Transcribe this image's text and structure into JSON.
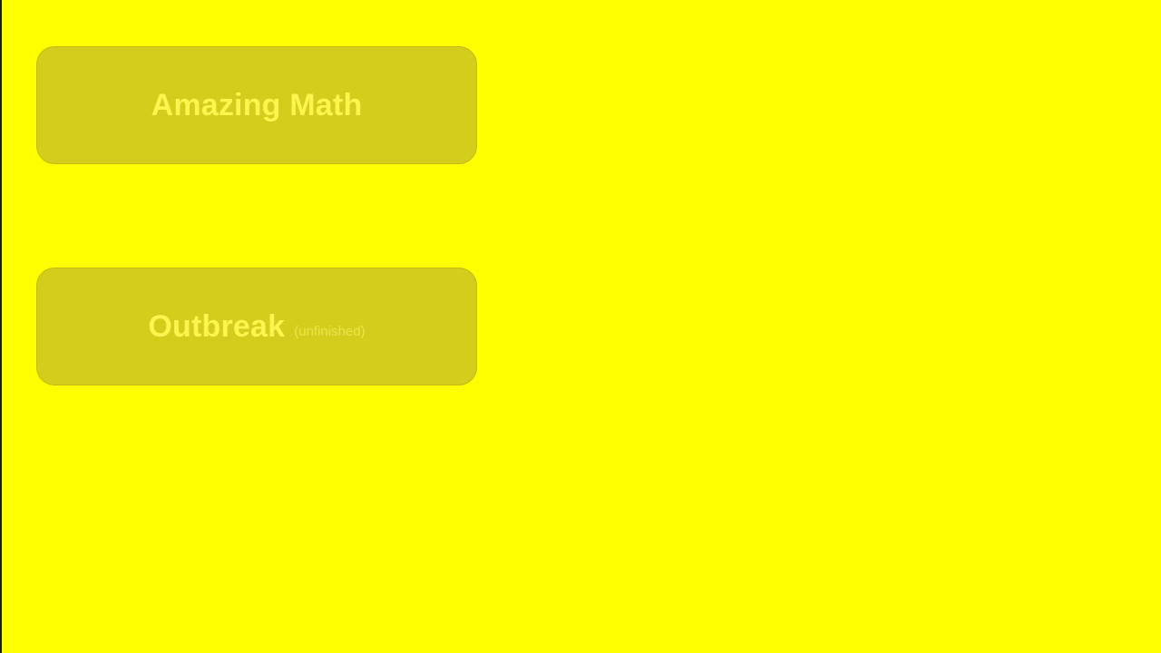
{
  "colors": {
    "background": "#ffff00",
    "button_fill": "#d4cd1c",
    "button_text": "#fbf54e"
  },
  "menu": {
    "items": [
      {
        "label": "Amazing Math"
      },
      {
        "label": "Outbreak",
        "note": "(unfinished)"
      }
    ]
  }
}
